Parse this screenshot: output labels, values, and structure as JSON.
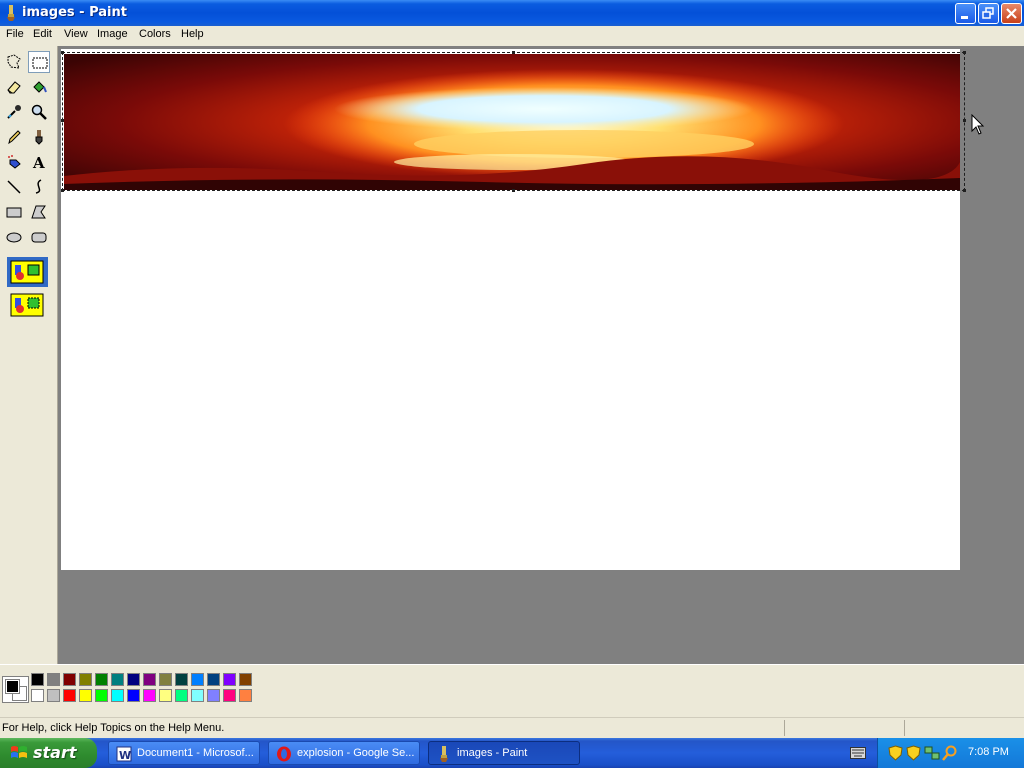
{
  "window": {
    "title": "images - Paint"
  },
  "menu": {
    "items": [
      "File",
      "Edit",
      "View",
      "Image",
      "Colors",
      "Help"
    ]
  },
  "toolbox": {
    "tools": [
      "free-form-select",
      "select",
      "eraser",
      "fill-with-color",
      "pick-color",
      "magnifier",
      "pencil",
      "brush",
      "airbrush",
      "text",
      "line",
      "curve",
      "rectangle",
      "polygon",
      "ellipse",
      "rounded-rectangle"
    ],
    "selected_tool": "select",
    "selection_modes": [
      "opaque-selection",
      "transparent-selection"
    ]
  },
  "palette": {
    "foreground": "#000000",
    "background": "#ffffff",
    "top_row": [
      "#000000",
      "#808080",
      "#800000",
      "#808000",
      "#008000",
      "#008080",
      "#000080",
      "#800080",
      "#808040",
      "#004040",
      "#0080ff",
      "#004080",
      "#8000ff",
      "#804000"
    ],
    "bottom_row": [
      "#ffffff",
      "#c0c0c0",
      "#ff0000",
      "#ffff00",
      "#00ff00",
      "#00ffff",
      "#0000ff",
      "#ff00ff",
      "#ffff80",
      "#00ff80",
      "#80ffff",
      "#8080ff",
      "#ff0080",
      "#ff8040"
    ]
  },
  "status": {
    "help_text": "For Help, click Help Topics on the Help Menu."
  },
  "taskbar": {
    "start_label": "start",
    "tasks": [
      {
        "label": "Document1 - Microsof...",
        "icon": "word-icon",
        "active": false
      },
      {
        "label": "explosion - Google Se...",
        "icon": "opera-icon",
        "active": false
      },
      {
        "label": "images - Paint",
        "icon": "paint-icon",
        "active": true
      }
    ],
    "clock": "7:08 PM"
  },
  "colors": {
    "titlebar": "#0a5ce0",
    "workspace": "#808080",
    "chrome": "#ece9d8"
  }
}
